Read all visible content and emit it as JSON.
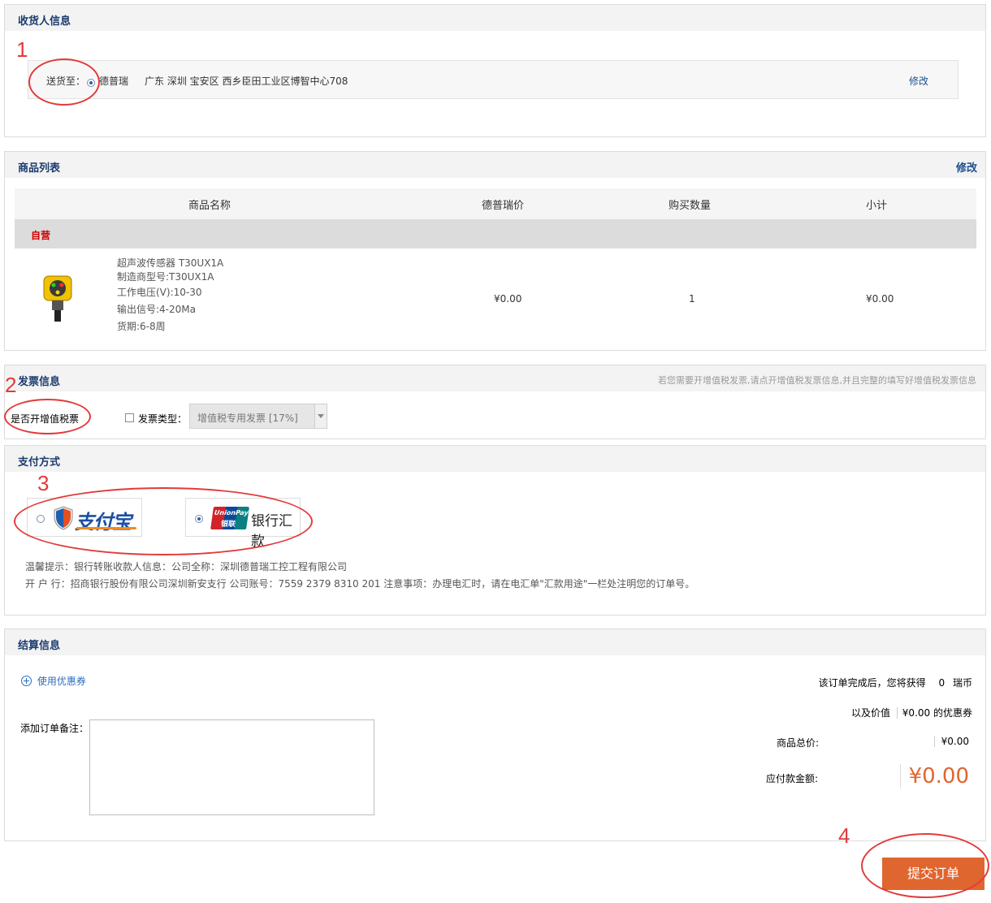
{
  "consignee": {
    "title": "收货人信息",
    "ship_to_label": "送货至：",
    "recipient": "德普瑞",
    "address": "广东 深圳 宝安区 西乡臣田工业区博智中心708",
    "edit_label": "修改"
  },
  "products": {
    "title": "商品列表",
    "edit_label": "修改",
    "columns": [
      "商品名称",
      "德普瑞价",
      "购买数量",
      "小计"
    ],
    "group_label": "自营",
    "item": {
      "lines": [
        "超声波传感器 T30UX1A",
        "制造商型号:T30UX1A",
        "工作电压(V):10-30",
        "输出信号:4-20Ma",
        "货期:6-8周"
      ],
      "price": "¥0.00",
      "quantity": "1",
      "subtotal": "¥0.00",
      "image_icon": "ultrasonic-sensor-icon"
    }
  },
  "invoice": {
    "title": "发票信息",
    "hint": "若您需要开增值税发票,请点开增值税发票信息,并且完整的填写好增值税发票信息",
    "vat_question": "是否开增值税票",
    "type_label": "发票类型：",
    "type_value": "增值税专用发票 [17%]"
  },
  "payment": {
    "title": "支付方式",
    "alipay_text": "支付宝",
    "unionpay_logo_en": "UnionPay",
    "unionpay_logo_cn": "银联",
    "bank_transfer_text": "银行汇款",
    "tip_line1": "温馨提示：银行转账收款人信息：公司全称：深圳德普瑞工控工程有限公司",
    "tip_line2": "开 户 行：招商银行股份有限公司深圳新安支行   公司账号：7559 2379 8310 201  注意事项：办理电汇时，请在电汇单\"汇款用途\"一栏处注明您的订单号。"
  },
  "settlement": {
    "title": "结算信息",
    "coupon_label": "使用优惠券",
    "remark_label": "添加订单备注：",
    "reward_prefix": "该订单完成后，您将获得",
    "reward_value": "0",
    "reward_unit": "瑞币",
    "coupon_prefix": "以及价值",
    "coupon_value": "¥0.00",
    "coupon_suffix": "的优惠券",
    "goods_total_label": "商品总价:",
    "goods_total_value": "¥0.00",
    "payable_label": "应付款金额:",
    "payable_value": "¥0.00"
  },
  "submit_label": "提交订单",
  "annotations": [
    "1",
    "2",
    "3",
    "4"
  ],
  "colors": {
    "accent_orange": "#e0662f",
    "title_blue": "#1c3b6e",
    "annotation_red": "#e23b3b"
  }
}
